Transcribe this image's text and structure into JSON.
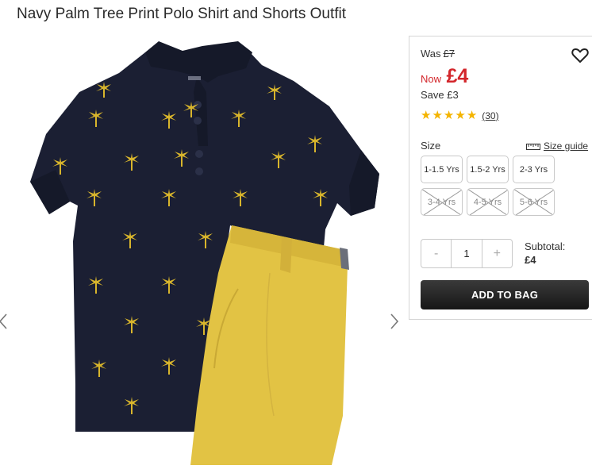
{
  "product": {
    "title": "Navy Palm Tree Print Polo Shirt and Shorts Outfit"
  },
  "gallery": {
    "image_alt": "Navy palm tree print polo shirt with mustard shorts",
    "prev_icon": "chevron-left-icon",
    "next_icon": "chevron-right-icon",
    "colors": {
      "shirt": "#1b1f33",
      "print": "#d8b52c",
      "shorts": "#e2c344"
    }
  },
  "pricing": {
    "was_label": "Was",
    "was_price": "£7",
    "now_label": "Now",
    "now_price": "£4",
    "save_text": "Save £3",
    "accent": "#d3262b"
  },
  "rating": {
    "stars": 5,
    "review_count": "(30)",
    "star_color": "#f4b400"
  },
  "wishlist": {
    "icon": "heart-icon"
  },
  "size": {
    "label": "Size",
    "guide_label": "Size guide",
    "guide_icon": "ruler-icon",
    "options": [
      {
        "label": "1-1.5 Yrs",
        "available": true
      },
      {
        "label": "1.5-2 Yrs",
        "available": true
      },
      {
        "label": "2-3 Yrs",
        "available": true
      },
      {
        "label": "3-4 Yrs",
        "available": false
      },
      {
        "label": "4-5 Yrs",
        "available": false
      },
      {
        "label": "5-6 Yrs",
        "available": false
      }
    ]
  },
  "quantity": {
    "minus": "-",
    "value": "1",
    "plus": "+"
  },
  "subtotal": {
    "label": "Subtotal:",
    "value": "£4"
  },
  "cta": {
    "add_to_bag": "ADD TO BAG",
    "color": "#1e1e1e"
  }
}
